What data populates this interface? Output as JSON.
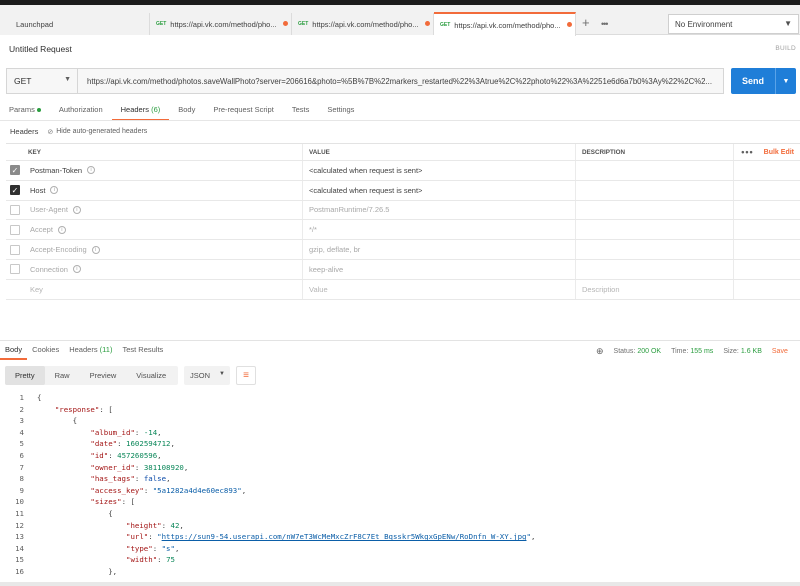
{
  "tabs": [
    {
      "method": "",
      "title": "Launchpad",
      "dot": false
    },
    {
      "method": "GET",
      "title": "https://api.vk.com/method/pho...",
      "dot": true
    },
    {
      "method": "GET",
      "title": "https://api.vk.com/method/pho...",
      "dot": true
    },
    {
      "method": "GET",
      "title": "https://api.vk.com/method/pho...",
      "dot": true
    }
  ],
  "env": {
    "label": "No Environment"
  },
  "request": {
    "title": "Untitled Request",
    "build": "BUILD",
    "method": "GET",
    "url": "https://api.vk.com/method/photos.saveWallPhoto?server=206616&photo=%5B%7B%22markers_restarted%22%3Atrue%2C%22photo%22%3A%2251e6d6a7b0%3Ay%22%2C%2...",
    "send": "Send"
  },
  "reqtabs": [
    {
      "label": "Params",
      "count": "",
      "dot": true
    },
    {
      "label": "Authorization",
      "count": "",
      "dot": false
    },
    {
      "label": "Headers",
      "count": "(6)",
      "dot": false
    },
    {
      "label": "Body",
      "count": "",
      "dot": false
    },
    {
      "label": "Pre-request Script",
      "count": "",
      "dot": false
    },
    {
      "label": "Tests",
      "count": "",
      "dot": false
    },
    {
      "label": "Settings",
      "count": "",
      "dot": false
    }
  ],
  "headers_section": {
    "label": "Headers",
    "hide_auto": "Hide auto-generated headers"
  },
  "table": {
    "columns": {
      "key": "KEY",
      "value": "VALUE",
      "description": "DESCRIPTION",
      "bulk_edit": "Bulk Edit"
    },
    "rows": [
      {
        "key": "Postman-Token",
        "value": "<calculated when request is sent>",
        "checked": "dim"
      },
      {
        "key": "Host",
        "value": "<calculated when request is sent>",
        "checked": "on"
      },
      {
        "key": "User-Agent",
        "value": "PostmanRuntime/7.26.5",
        "checked": "off"
      },
      {
        "key": "Accept",
        "value": "*/*",
        "checked": "off"
      },
      {
        "key": "Accept-Encoding",
        "value": "gzip, deflate, br",
        "checked": "off"
      },
      {
        "key": "Connection",
        "value": "keep-alive",
        "checked": "off"
      }
    ],
    "new_row": {
      "key": "Key",
      "value": "Value",
      "description": "Description"
    }
  },
  "response": {
    "tabs": [
      {
        "label": "Body",
        "count": ""
      },
      {
        "label": "Cookies",
        "count": ""
      },
      {
        "label": "Headers",
        "count": "(11)"
      },
      {
        "label": "Test Results",
        "count": ""
      }
    ],
    "status_label": "Status:",
    "status_value": "200 OK",
    "time_label": "Time:",
    "time_value": "155 ms",
    "size_label": "Size:",
    "size_value": "1.6 KB",
    "save": "Save",
    "views": [
      "Pretty",
      "Raw",
      "Preview",
      "Visualize"
    ],
    "format": "JSON",
    "url_value": "https://sun9-54.userapi.com/nW7eT3WcMeMxcZrF8C7Et_Bqsskr5WkgxGpENw/RoDnfn_W-XY.jpg"
  }
}
